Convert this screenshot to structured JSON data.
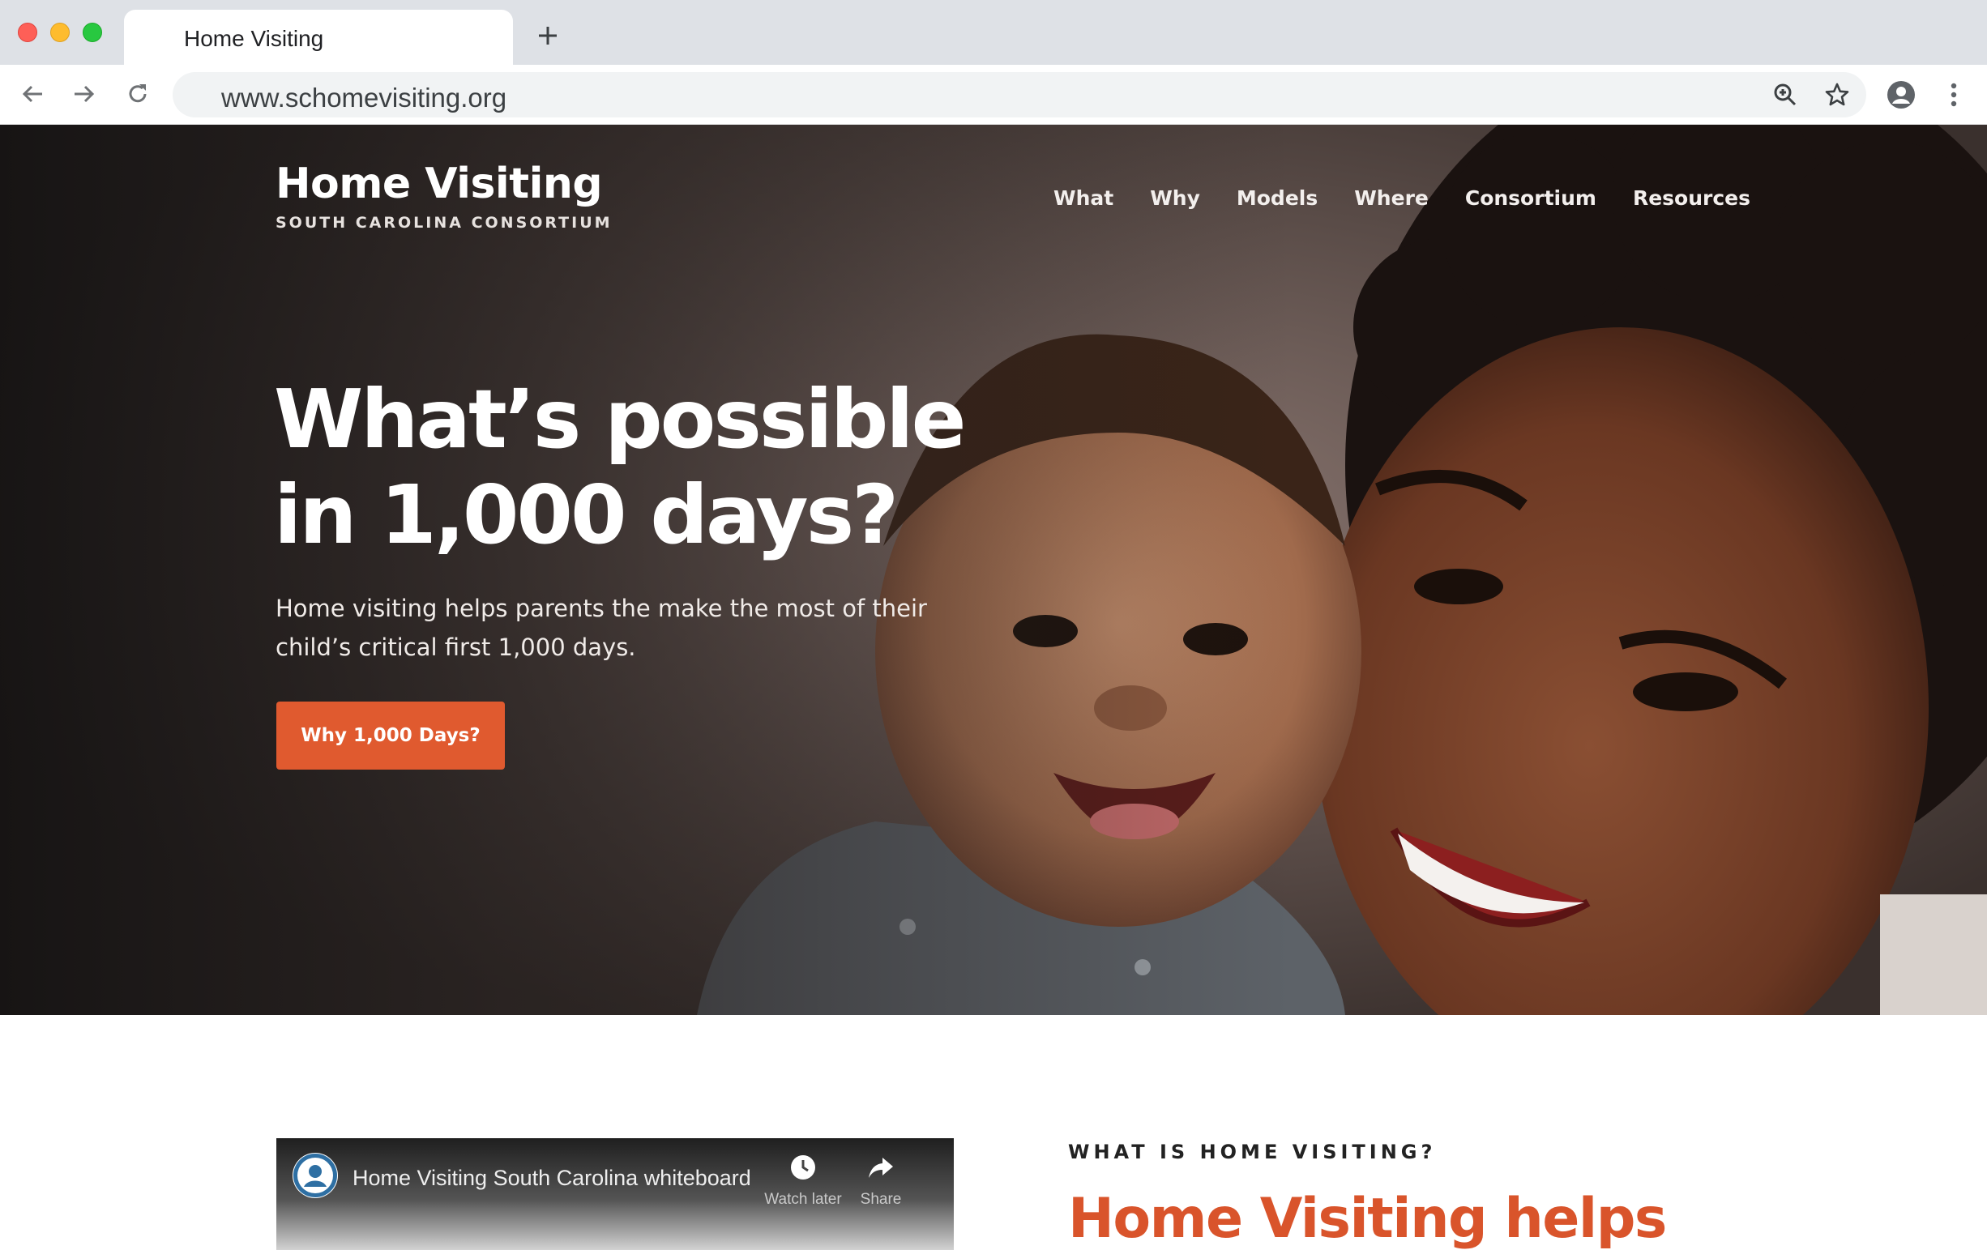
{
  "browser": {
    "tab_title": "Home Visiting",
    "url": "www.schomevisiting.org",
    "icons": {
      "new_tab": "plus-icon",
      "back": "arrow-left-icon",
      "forward": "arrow-right-icon",
      "reload": "reload-icon",
      "zoom": "zoom-in-icon",
      "bookmark": "star-icon",
      "profile": "account-circle-icon",
      "menu": "vertical-dots-icon"
    }
  },
  "site": {
    "logo_title": "Home Visiting",
    "logo_subtitle": "SOUTH CAROLINA CONSORTIUM",
    "nav": [
      "What",
      "Why",
      "Models",
      "Where",
      "Consortium",
      "Resources"
    ],
    "hero": {
      "headline_line1": "What’s possible",
      "headline_line2": "in 1,000 days?",
      "subcopy": "Home visiting helps parents the make the most of their child’s critical first 1,000 days.",
      "cta_label": "Why 1,000 Days?"
    },
    "video": {
      "title": "Home Visiting South Carolina whiteboard",
      "watch_later": "Watch later",
      "share": "Share"
    },
    "section": {
      "eyebrow": "WHAT IS HOME VISITING?",
      "title": "Home Visiting helps"
    }
  },
  "colors": {
    "accent": "#e05a2f",
    "section_title": "#d9542b",
    "chrome_bg": "#dee1e6"
  }
}
